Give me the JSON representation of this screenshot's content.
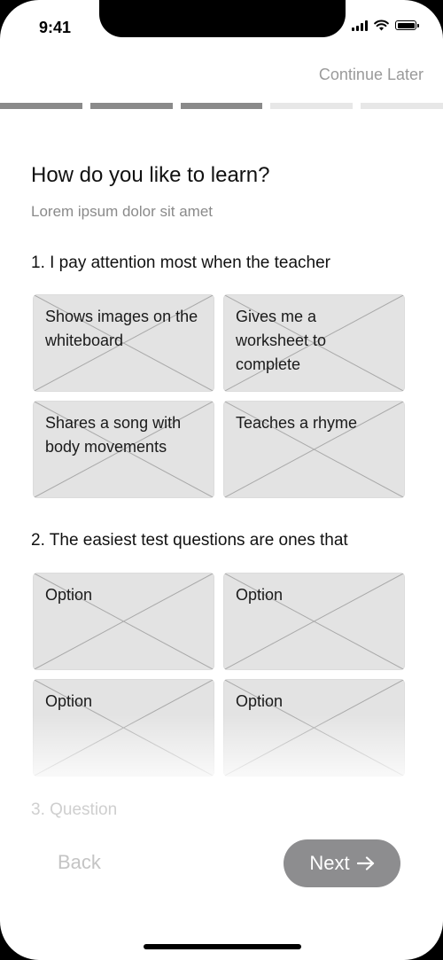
{
  "status_bar": {
    "time": "9:41"
  },
  "header": {
    "continue_later": "Continue Later"
  },
  "progress": {
    "total_steps": 5,
    "completed_steps": 3
  },
  "page": {
    "title": "How do you like to learn?",
    "subtitle": "Lorem ipsum dolor sit amet"
  },
  "questions": [
    {
      "text": "1. I pay attention most when the teacher",
      "options": [
        "Shows images on the whiteboard",
        "Gives me a worksheet to complete",
        "Shares a song with body movements",
        "Teaches a rhyme"
      ]
    },
    {
      "text": "2. The easiest test questions are ones that",
      "options": [
        "Option",
        "Option",
        "Option",
        "Option"
      ]
    },
    {
      "text": "3. Question"
    }
  ],
  "footer": {
    "back": "Back",
    "next": "Next",
    "next_icon": "arrow-right-icon"
  },
  "colors": {
    "progress_done": "#8a8a8a",
    "progress_todo": "#e7e7e7",
    "card_bg": "#e3e3e3",
    "next_button": "#8d8d8f"
  }
}
